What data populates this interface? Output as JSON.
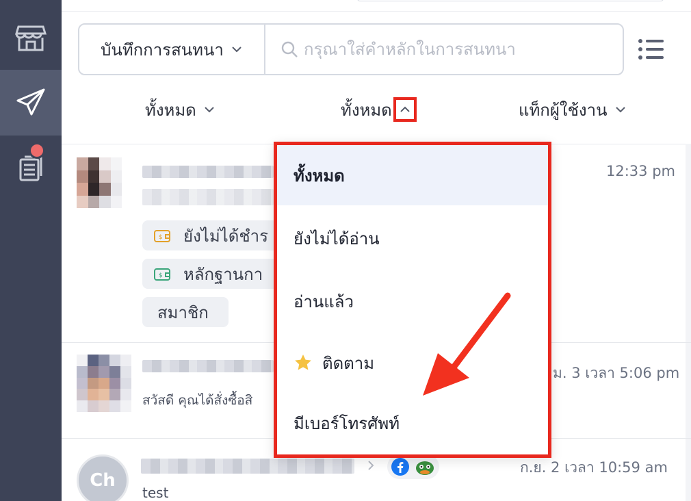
{
  "sidebar": {
    "items": [
      {
        "name": "store",
        "icon": "store-icon"
      },
      {
        "name": "send",
        "icon": "paper-plane-icon",
        "active": true
      },
      {
        "name": "docs",
        "icon": "documents-icon",
        "has_badge": true
      }
    ]
  },
  "search": {
    "scope_label": "บันทึกการสนทนา",
    "placeholder": "กรุณาใส่คำหลักในการสนทนา",
    "value": ""
  },
  "filters": {
    "first": "ทั้งหมด",
    "second": "ทั้งหมด",
    "third": "แท็กผู้ใช้งาน"
  },
  "dropdown": {
    "items": [
      {
        "label": "ทั้งหมด",
        "selected": true
      },
      {
        "label": "ยังไม่ได้อ่าน"
      },
      {
        "label": "อ่านแล้ว"
      },
      {
        "label": "ติดตาม",
        "icon": "star-icon"
      },
      {
        "label": "มีเบอร์โทรศัพท์"
      }
    ]
  },
  "conversations": [
    {
      "time": "12:33 pm",
      "tags": [
        "ยังไม่ได้ชำร",
        "หลักฐานกา",
        "สมาชิก"
      ]
    },
    {
      "time": "ม. 3 เวลา 5:06 pm",
      "snippet": "สวัสดี คุณได้สั่งซื้อสิ"
    },
    {
      "avatar_initials": "Ch",
      "time": "ก.ย. 2 เวลา 10:59 am",
      "snippet": "test",
      "platform": "facebook-icon"
    }
  ],
  "colors": {
    "sidebar": "#3d4357",
    "highlight": "#e8281e",
    "selected_row": "#eef2fb"
  }
}
